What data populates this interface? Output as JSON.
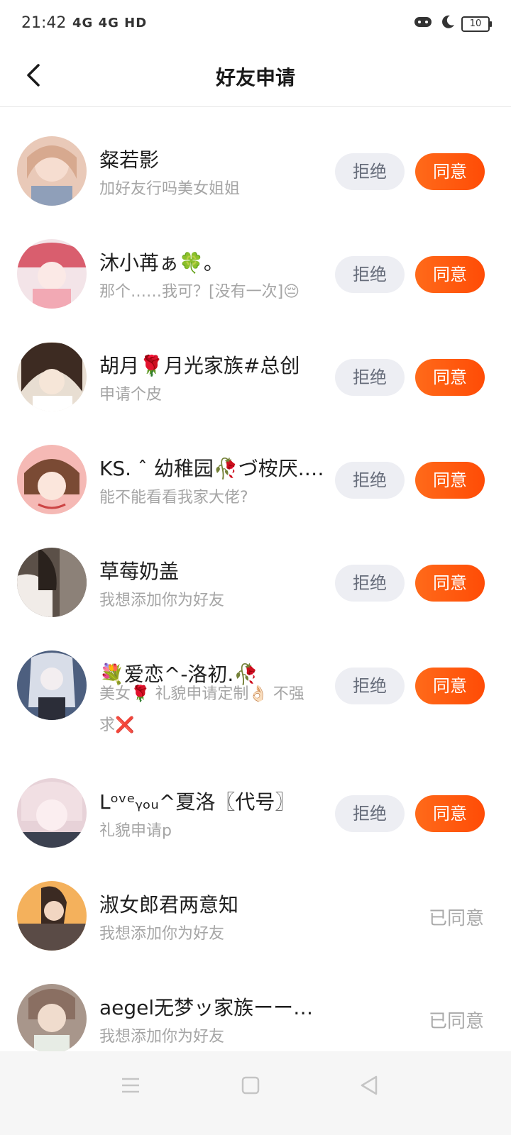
{
  "status_bar": {
    "time": "21:42",
    "signal": "4G 4G HD",
    "battery": "10"
  },
  "header": {
    "title": "好友申请"
  },
  "colors": {
    "accent": "#ff5a0f",
    "reject_bg": "#edeef3",
    "secondary_text": "#a5a5a5"
  },
  "requests": [
    {
      "name": "粲若影",
      "message": "加好友行吗美女姐姐",
      "status": "pending",
      "reject_label": "拒绝",
      "agree_label": "同意"
    },
    {
      "name": "沐小苒ぁ🍀。",
      "message": "那个……我可？[没有一次]😔",
      "status": "pending",
      "reject_label": "拒绝",
      "agree_label": "同意"
    },
    {
      "name": "胡月🌹月光家族#总创",
      "message": "申请个皮",
      "status": "pending",
      "reject_label": "拒绝",
      "agree_label": "同意"
    },
    {
      "name": "KS. ˆ 幼稚园🥀づ桉厌.…",
      "message": "能不能看看我家大佬?",
      "status": "pending",
      "reject_label": "拒绝",
      "agree_label": "同意"
    },
    {
      "name": "草莓奶盖",
      "message": "我想添加你为好友",
      "status": "pending",
      "reject_label": "拒绝",
      "agree_label": "同意"
    },
    {
      "name": "💐爱恋^-洛初.🥀",
      "message": "美女🌹 礼貌申请定制👌🏻 不强求❌",
      "status": "pending",
      "reject_label": "拒绝",
      "agree_label": "同意"
    },
    {
      "name": "Lᵒᵛᵉᵧₒᵤ^夏洛〖代号〗",
      "message": "礼貌申请p",
      "status": "pending",
      "reject_label": "拒绝",
      "agree_label": "同意"
    },
    {
      "name": "淑女郎君两意知",
      "message": "我想添加你为好友",
      "status": "agreed",
      "agreed_label": "已同意"
    },
    {
      "name": "aegel无梦ッ家族ーー白沫",
      "message": "我想添加你为好友",
      "status": "agreed",
      "agreed_label": "已同意"
    }
  ]
}
